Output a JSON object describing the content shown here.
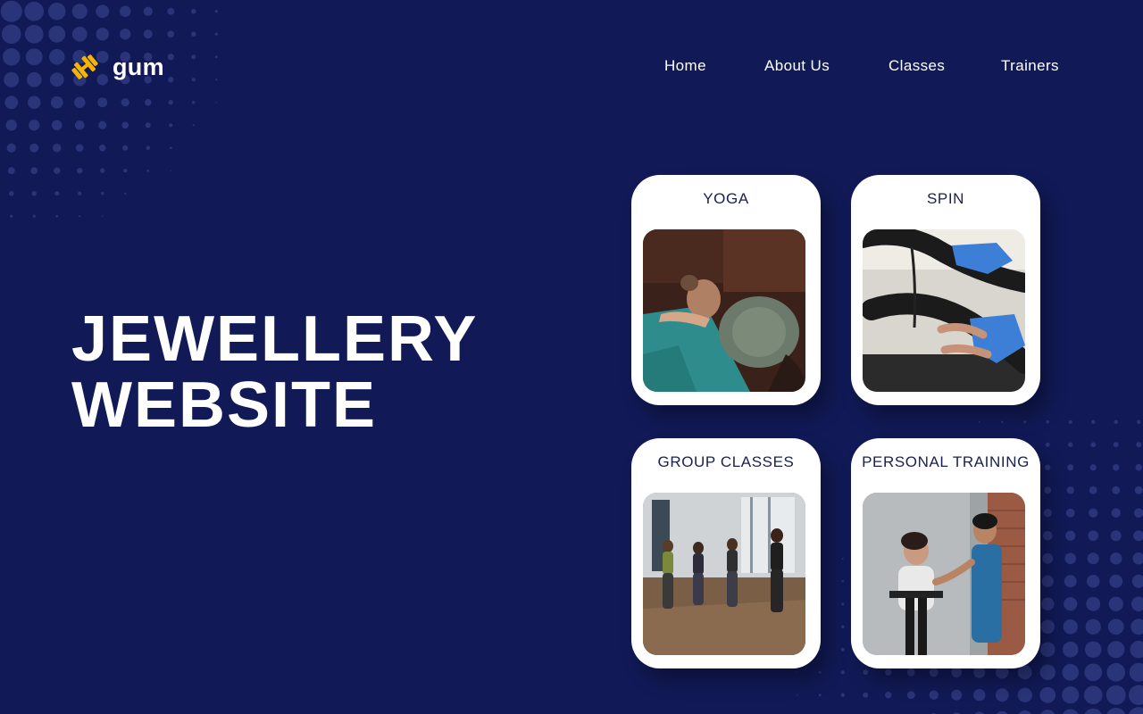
{
  "brand": {
    "name": "gum",
    "icon": "dumbbell-icon",
    "accent": "#f5b400"
  },
  "nav": {
    "items": [
      "Home",
      "About Us",
      "Classes",
      "Trainers"
    ]
  },
  "hero": {
    "line1": "JEWELLERY",
    "line2": "WEBSITE"
  },
  "classes": [
    {
      "title": "YOGA",
      "image": "yoga-photo"
    },
    {
      "title": "SPIN",
      "image": "spin-photo"
    },
    {
      "title": "GROUP CLASSES",
      "image": "group-classes-photo"
    },
    {
      "title": "PERSONAL TRAINING",
      "image": "personal-training-photo"
    }
  ],
  "colors": {
    "background": "#111a57",
    "card": "#ffffff",
    "card_text": "#1a2050",
    "dots": "#2a3478"
  }
}
